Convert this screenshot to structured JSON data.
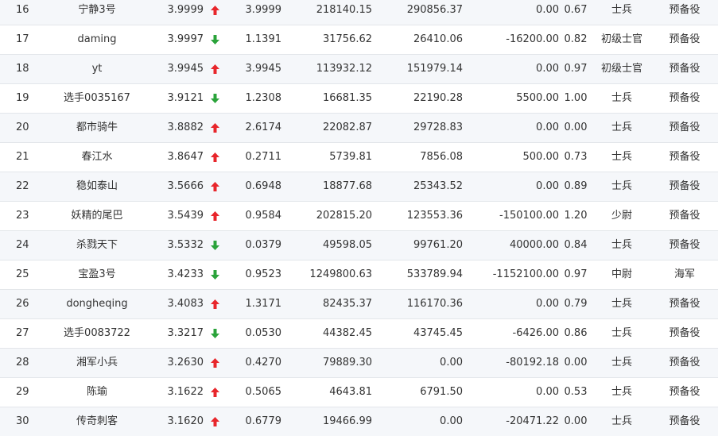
{
  "colors": {
    "up": "#e8262b",
    "down": "#2aa33a",
    "row_alt": "#f5f7fa",
    "text": "#333333",
    "border": "#e3e6ea"
  },
  "icons": {
    "up": "red-up-arrow-icon",
    "down": "green-down-arrow-icon"
  },
  "rows": [
    {
      "rank": "16",
      "name": "宁静3号",
      "nav": "3.9999",
      "trend": "up",
      "value2": "3.9999",
      "amount1": "218140.15",
      "amount2": "290856.37",
      "amount3": "0.00",
      "ratio": "0.67",
      "title": "士兵",
      "status": "预备役"
    },
    {
      "rank": "17",
      "name": "daming",
      "nav": "3.9997",
      "trend": "down",
      "value2": "1.1391",
      "amount1": "31756.62",
      "amount2": "26410.06",
      "amount3": "-16200.00",
      "ratio": "0.82",
      "title": "初级士官",
      "status": "预备役"
    },
    {
      "rank": "18",
      "name": "yt",
      "nav": "3.9945",
      "trend": "up",
      "value2": "3.9945",
      "amount1": "113932.12",
      "amount2": "151979.14",
      "amount3": "0.00",
      "ratio": "0.97",
      "title": "初级士官",
      "status": "预备役"
    },
    {
      "rank": "19",
      "name": "选手0035167",
      "nav": "3.9121",
      "trend": "down",
      "value2": "1.2308",
      "amount1": "16681.35",
      "amount2": "22190.28",
      "amount3": "5500.00",
      "ratio": "1.00",
      "title": "士兵",
      "status": "预备役"
    },
    {
      "rank": "20",
      "name": "都市骑牛",
      "nav": "3.8882",
      "trend": "up",
      "value2": "2.6174",
      "amount1": "22082.87",
      "amount2": "29728.83",
      "amount3": "0.00",
      "ratio": "0.00",
      "title": "士兵",
      "status": "预备役"
    },
    {
      "rank": "21",
      "name": "春江水",
      "nav": "3.8647",
      "trend": "up",
      "value2": "0.2711",
      "amount1": "5739.81",
      "amount2": "7856.08",
      "amount3": "500.00",
      "ratio": "0.73",
      "title": "士兵",
      "status": "预备役"
    },
    {
      "rank": "22",
      "name": "稳如泰山",
      "nav": "3.5666",
      "trend": "up",
      "value2": "0.6948",
      "amount1": "18877.68",
      "amount2": "25343.52",
      "amount3": "0.00",
      "ratio": "0.89",
      "title": "士兵",
      "status": "预备役"
    },
    {
      "rank": "23",
      "name": "妖精的尾巴",
      "nav": "3.5439",
      "trend": "up",
      "value2": "0.9584",
      "amount1": "202815.20",
      "amount2": "123553.36",
      "amount3": "-150100.00",
      "ratio": "1.20",
      "title": "少尉",
      "status": "预备役"
    },
    {
      "rank": "24",
      "name": "杀戮天下",
      "nav": "3.5332",
      "trend": "down",
      "value2": "0.0379",
      "amount1": "49598.05",
      "amount2": "99761.20",
      "amount3": "40000.00",
      "ratio": "0.84",
      "title": "士兵",
      "status": "预备役"
    },
    {
      "rank": "25",
      "name": "宝盈3号",
      "nav": "3.4233",
      "trend": "down",
      "value2": "0.9523",
      "amount1": "1249800.63",
      "amount2": "533789.94",
      "amount3": "-1152100.00",
      "ratio": "0.97",
      "title": "中尉",
      "status": "海军"
    },
    {
      "rank": "26",
      "name": "dongheqing",
      "nav": "3.4083",
      "trend": "up",
      "value2": "1.3171",
      "amount1": "82435.37",
      "amount2": "116170.36",
      "amount3": "0.00",
      "ratio": "0.79",
      "title": "士兵",
      "status": "预备役"
    },
    {
      "rank": "27",
      "name": "选手0083722",
      "nav": "3.3217",
      "trend": "down",
      "value2": "0.0530",
      "amount1": "44382.45",
      "amount2": "43745.45",
      "amount3": "-6426.00",
      "ratio": "0.86",
      "title": "士兵",
      "status": "预备役"
    },
    {
      "rank": "28",
      "name": "湘军小兵",
      "nav": "3.2630",
      "trend": "up",
      "value2": "0.4270",
      "amount1": "79889.30",
      "amount2": "0.00",
      "amount3": "-80192.18",
      "ratio": "0.00",
      "title": "士兵",
      "status": "预备役"
    },
    {
      "rank": "29",
      "name": "陈瑜",
      "nav": "3.1622",
      "trend": "up",
      "value2": "0.5065",
      "amount1": "4643.81",
      "amount2": "6791.50",
      "amount3": "0.00",
      "ratio": "0.53",
      "title": "士兵",
      "status": "预备役"
    },
    {
      "rank": "30",
      "name": "传奇刺客",
      "nav": "3.1620",
      "trend": "up",
      "value2": "0.6779",
      "amount1": "19466.99",
      "amount2": "0.00",
      "amount3": "-20471.22",
      "ratio": "0.00",
      "title": "士兵",
      "status": "预备役"
    }
  ]
}
